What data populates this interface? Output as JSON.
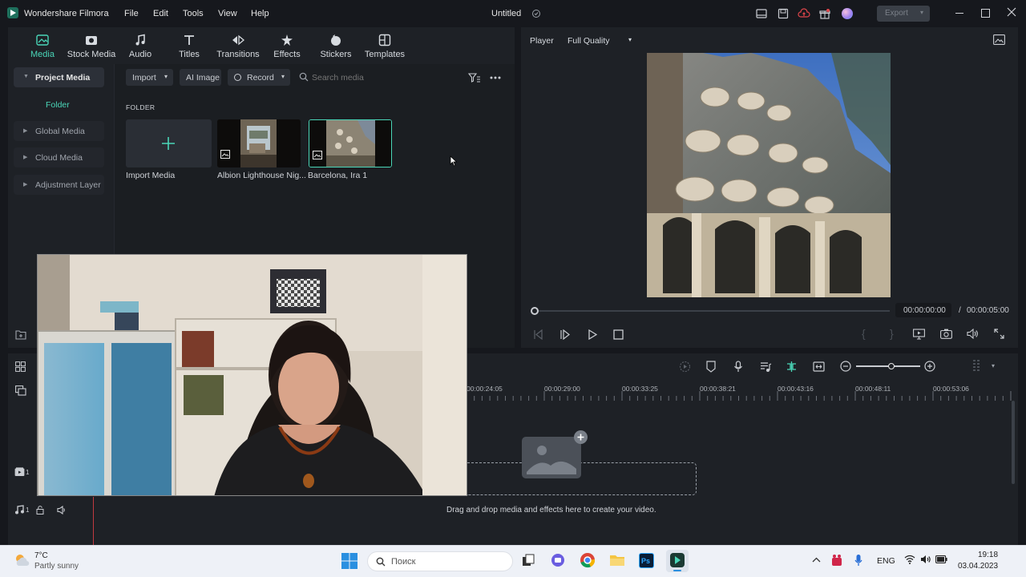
{
  "app": {
    "name": "Wondershare Filmora",
    "project_title": "Untitled",
    "export_label": "Export",
    "menu": [
      "File",
      "Edit",
      "Tools",
      "View",
      "Help"
    ]
  },
  "tabs": [
    "Media",
    "Stock Media",
    "Audio",
    "Titles",
    "Transitions",
    "Effects",
    "Stickers",
    "Templates"
  ],
  "sidebar": {
    "items": [
      "Project Media",
      "Folder",
      "Global Media",
      "Cloud Media",
      "Adjustment Layer"
    ]
  },
  "media_toolbar": {
    "import": "Import",
    "ai_image": "AI Image",
    "record": "Record",
    "search_placeholder": "Search media"
  },
  "media": {
    "section_label": "FOLDER",
    "items": [
      "Import Media",
      "Albion Lighthouse Nig...",
      "Barcelona, Ira 1"
    ]
  },
  "player": {
    "label": "Player",
    "quality": "Full Quality",
    "current_time": "00:00:00:00",
    "separator": "/",
    "total_time": "00:00:05:00"
  },
  "timeline": {
    "ruler": [
      "00:00:24:05",
      "00:00:29:00",
      "00:00:33:25",
      "00:00:38:21",
      "00:00:43:16",
      "00:00:48:11",
      "00:00:53:06"
    ],
    "track_video": "1",
    "track_audio": "1",
    "drop_hint": "Drag and drop media and effects here to create your video."
  },
  "taskbar": {
    "weather_temp": "7°C",
    "weather_desc": "Partly sunny",
    "search_placeholder": "Поиск",
    "lang": "ENG",
    "time": "19:18",
    "date": "03.04.2023"
  },
  "colors": {
    "accent": "#4ad6b8",
    "panel": "#1e2126",
    "background": "#16181d"
  }
}
